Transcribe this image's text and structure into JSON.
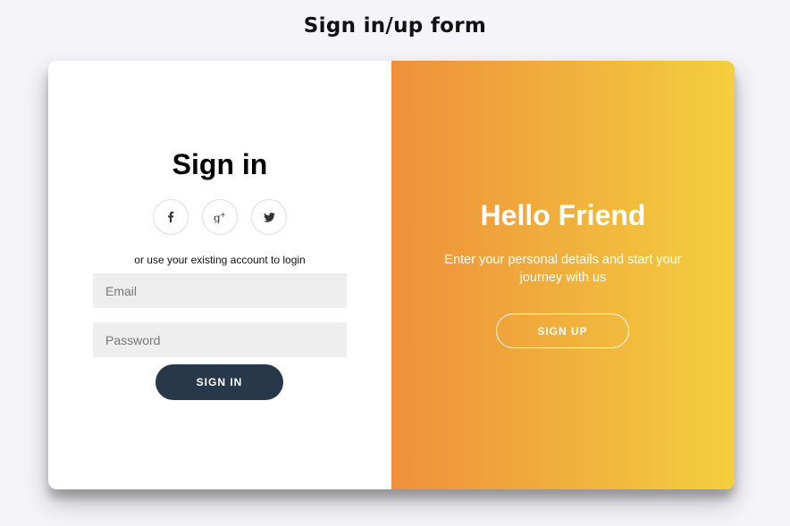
{
  "page": {
    "title": "Sign in/up form"
  },
  "signin": {
    "title": "Sign in",
    "social": [
      {
        "icon": "facebook-icon",
        "glyph": "f"
      },
      {
        "icon": "google-plus-icon",
        "glyph": "g+"
      },
      {
        "icon": "twitter-icon",
        "glyph": "bird"
      }
    ],
    "hint": "or use your existing account to login",
    "email_placeholder": "Email",
    "password_placeholder": "Password",
    "button_label": "SIGN IN"
  },
  "overlay": {
    "title": "Hello Friend",
    "text": "Enter your personal details and start your journey with us",
    "button_label": "SIGN UP"
  },
  "colors": {
    "page_bg": "#f5f4f8",
    "gradient_start": "#ee903b",
    "gradient_end": "#f3cf3e",
    "signin_button": "#263849",
    "input_bg": "#eeeeee"
  }
}
